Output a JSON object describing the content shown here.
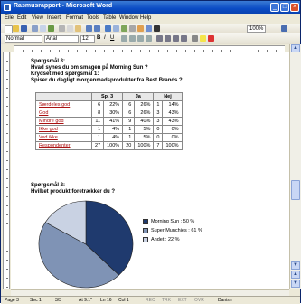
{
  "window": {
    "title": "Rasmusrapport - Microsoft Word"
  },
  "menu": [
    "Eile",
    "Edit",
    "View",
    "Insert",
    "Format",
    "Tools",
    "Table",
    "Window",
    "Help"
  ],
  "toolbar": {
    "zoom": "100%",
    "style": "Normal",
    "font": "Arial",
    "size": "12"
  },
  "document": {
    "q3_title": "Spørgsmål 3:",
    "q3_text": "Hvad synes du om smagen på Morning Sun ?",
    "crosstab_title": "Krydset med spørgsmål 1:",
    "crosstab_text": "Spiser du dagligt morgenmadsprodukter fra Best Brands ?",
    "table": {
      "headers": [
        "",
        "Sp. 3",
        "",
        "Ja",
        "",
        "Nej",
        ""
      ],
      "rows": [
        [
          "Særdeles god",
          "6",
          "22%",
          "6",
          "26%",
          "1",
          "14%"
        ],
        [
          "God",
          "8",
          "30%",
          "6",
          "26%",
          "3",
          "43%"
        ],
        [
          "Mindre god",
          "11",
          "41%",
          "9",
          "40%",
          "3",
          "43%"
        ],
        [
          "Ikke god",
          "1",
          "4%",
          "1",
          "5%",
          "0",
          "0%"
        ],
        [
          "Ved ikke",
          "1",
          "4%",
          "1",
          "5%",
          "0",
          "0%"
        ],
        [
          "Respondenter",
          "27",
          "100%",
          "20",
          "100%",
          "7",
          "100%"
        ]
      ]
    },
    "q4_title": "Spørgsmål 2:",
    "q4_text": "Hvilket produkt foretrækker du ?"
  },
  "chart_data": {
    "type": "pie",
    "series": [
      {
        "name": "Morning Sun : 50 %",
        "value": 50,
        "color": "#1f3a6e"
      },
      {
        "name": "Super Munchies : 61 %",
        "value": 61,
        "color": "#7f93b5"
      },
      {
        "name": "Andet : 22 %",
        "value": 22,
        "color": "#c9d2e3"
      }
    ]
  },
  "status": {
    "page": "Page 3",
    "sec": "Sec 1",
    "pages": "3/3",
    "at": "At 9.1\"",
    "ln": "Ln 16",
    "col": "Col 1",
    "rec": "REC",
    "trk": "TRK",
    "ext": "EXT",
    "ovr": "OVR",
    "lang": "Danish"
  },
  "colors": {
    "titlebar": "#0b4cc5",
    "table_label": "#a11111"
  }
}
